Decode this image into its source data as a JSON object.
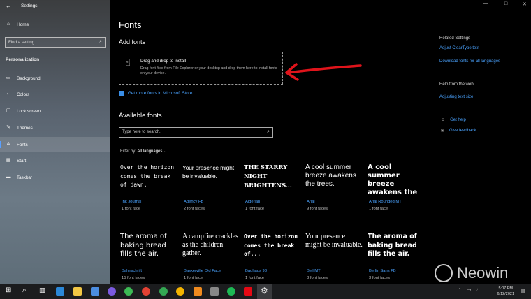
{
  "window": {
    "title": "Settings",
    "minimize": "—",
    "maximize": "□",
    "close": "✕"
  },
  "sidebar": {
    "home": "Home",
    "search_placeholder": "Find a setting",
    "section": "Personalization",
    "items": [
      {
        "label": "Background",
        "icon": "image-icon"
      },
      {
        "label": "Colors",
        "icon": "palette-icon"
      },
      {
        "label": "Lock screen",
        "icon": "lock-screen-icon"
      },
      {
        "label": "Themes",
        "icon": "brush-icon"
      },
      {
        "label": "Fonts",
        "icon": "font-icon"
      },
      {
        "label": "Start",
        "icon": "start-icon"
      },
      {
        "label": "Taskbar",
        "icon": "taskbar-icon"
      }
    ],
    "active_index": 4
  },
  "main": {
    "title": "Fonts",
    "add_fonts": "Add fonts",
    "dropzone_title": "Drag and drop to install",
    "dropzone_desc": "Drag font files from File Explorer or your desktop and drop them here to install fonts on your device.",
    "store_link": "Get more fonts in Microsoft Store",
    "available": "Available fonts",
    "search_placeholder": "Type here to search.",
    "filter_label": "Filter by:",
    "filter_value": "All languages",
    "fonts": [
      {
        "sample": "Over the horizon comes the break of dawn.",
        "name": "Ink Journal",
        "faces": "1 font face"
      },
      {
        "sample": "Your presence might be invaluable.",
        "name": "Agency FB",
        "faces": "2 font faces"
      },
      {
        "sample": "THE STARRY NIGHT BRIGHTENS...",
        "name": "Algerian",
        "faces": "1 font face"
      },
      {
        "sample": "A cool summer breeze awakens the trees.",
        "name": "Arial",
        "faces": "9 font faces"
      },
      {
        "sample": "A cool summer breeze awakens the t...",
        "name": "Arial Rounded MT",
        "faces": "1 font face"
      },
      {
        "sample": "The aroma of baking bread fills the air.",
        "name": "Bahnschrift",
        "faces": "15 font faces"
      },
      {
        "sample": "A campfire crackles as the children gather.",
        "name": "Baskerville Old Face",
        "faces": "1 font face"
      },
      {
        "sample": "Over the horizon comes the break of...",
        "name": "Bauhaus 93",
        "faces": "1 font face"
      },
      {
        "sample": "Your presence might be invaluable.",
        "name": "Bell MT",
        "faces": "3 font faces"
      },
      {
        "sample": "The aroma of baking bread fills the air.",
        "name": "Berlin Sans FB",
        "faces": "3 font faces"
      }
    ]
  },
  "right_panel": {
    "related_head": "Related Settings",
    "related_links": [
      "Adjust ClearType text",
      "Download fonts for all languages"
    ],
    "help_head": "Help from the web",
    "help_links": [
      "Adjusting text size"
    ],
    "get_help": "Get help",
    "feedback": "Give feedback"
  },
  "taskbar": {
    "time": "5:07 PM",
    "date": "6/12/2021"
  },
  "watermark": "Neowin"
}
